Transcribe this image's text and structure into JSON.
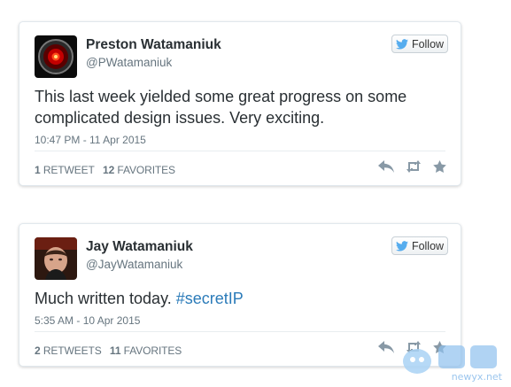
{
  "colors": {
    "twitter_blue": "#55acee",
    "link": "#2b7bb9",
    "text": "#292f33",
    "muted": "#66757f",
    "action_icon": "#8899a6"
  },
  "follow_label": "Follow",
  "tweets": [
    {
      "name": "Preston Watamaniuk",
      "handle": "@PWatamaniuk",
      "text": "This last week yielded some great progress on some complicated design issues.  Very exciting.",
      "timestamp": "10:47 PM - 11 Apr 2015",
      "retweet_count": "1",
      "retweet_label": "RETWEET",
      "favorite_count": "12",
      "favorite_label": "FAVORITES",
      "avatar": "hal-9000-eye"
    },
    {
      "name": "Jay Watamaniuk",
      "handle": "@JayWatamaniuk",
      "text_prefix": "Much written today. ",
      "hashtag": "#secretIP",
      "timestamp": "5:35 AM - 10 Apr 2015",
      "retweet_count": "2",
      "retweet_label": "RETWEETS",
      "favorite_count": "11",
      "favorite_label": "FAVORITES",
      "avatar": "person-photo"
    }
  ],
  "watermark": {
    "label": "newyx.net"
  }
}
